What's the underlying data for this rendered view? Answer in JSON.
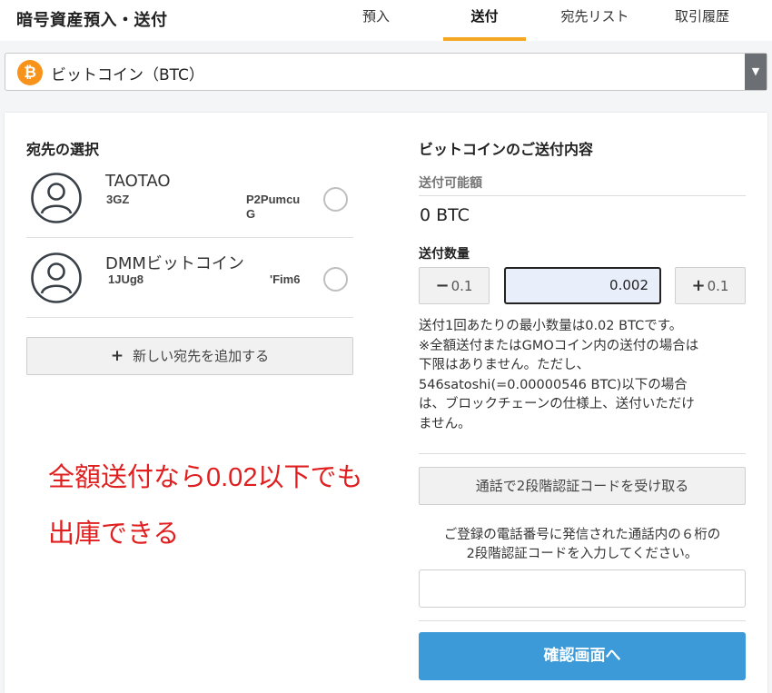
{
  "header": {
    "title": "暗号資産預入・送付",
    "tabs": [
      {
        "label": "預入"
      },
      {
        "label": "送付"
      },
      {
        "label": "宛先リスト"
      },
      {
        "label": "取引履歴"
      }
    ],
    "active_tab": "送付",
    "accent_color": "#f5a623"
  },
  "currency": {
    "icon": "bitcoin-icon",
    "icon_glyph": "₿",
    "label": "ビットコイン（BTC）"
  },
  "recipients_section": {
    "heading": "宛先の選択",
    "recipients": [
      {
        "name": "TAOTAO",
        "address_start": "3GZ",
        "address_end_1": "P2Pumcu",
        "address_end_2": "G"
      },
      {
        "name": "DMMビットコイン",
        "address_start": "1JUg8",
        "address_end_1": "'Fim6",
        "address_end_2": ""
      }
    ],
    "add_button": "新しい宛先を追加する",
    "annotation_line1": "全額送付なら0.02以下でも",
    "annotation_line2": "出庫できる"
  },
  "send_section": {
    "heading": "ビットコインのご送付内容",
    "available_label": "送付可能額",
    "available_amount": "0 BTC",
    "quantity_label": "送付数量",
    "minus_sign": "−",
    "minus_value": "0.1",
    "plus_sign": "+",
    "plus_value": "0.1",
    "quantity_value": "0.002",
    "notes": [
      "送付1回あたりの最小数量は0.02 BTCです。",
      "※全額送付またはGMOコイン内の送付の場合は",
      "下限はありません。ただし、",
      "546satoshi(=0.00000546 BTC)以下の場合",
      "は、ブロックチェーンの仕様上、送付いただけ",
      "ません。"
    ],
    "voice_button": "通話で2段階認証コードを受け取る",
    "code_help_1": "ご登録の電話番号に発信された通話内の６桁の",
    "code_help_2": "2段階認証コードを入力してください。",
    "code_input_value": "",
    "confirm_button": "確認画面へ",
    "confirm_color": "#3d9ad9"
  }
}
